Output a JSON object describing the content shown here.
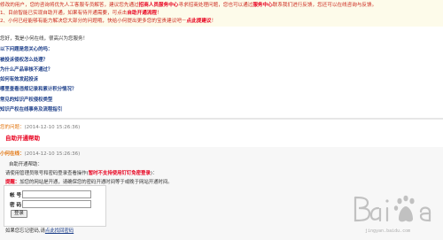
{
  "notice": {
    "line1_a": "修改的用户，您的咨询将优先人工客服专员解答，建议您先通过",
    "line1_hl1": "招商人员服务中心",
    "line1_b": "寻求招商处理问题，您也可以通过",
    "line1_hl2": "服务中心",
    "line1_c": "联系我们进行反馈，您还可以在线咨询与反馈。",
    "line2": "1、目前智能已实现自助开通，如果有待开通需要，可点击",
    "line2_hl": "自助开通流程",
    "line2_tail": "！",
    "line3": "2、小何已经能够有能力解决您大部分的问题哦，快给小何提出更多您的宝贵建议吧－",
    "line3_hl": "点此提建议",
    "line3_tail": "！"
  },
  "chat": {
    "greet_a": "您好，我是小何在线，很高兴为您服务！",
    "head": "以下问题是您关心的吗：",
    "questions": [
      "被投诉侵权怎么处理？",
      "为什么产品审核不通过？",
      "如何有效发起投诉",
      "哪里查看违规记录和累计积分情况？",
      "常见的知识产权侵权类型",
      "知识产权在线事务及流程指引"
    ]
  },
  "bubble": {
    "who": "您的问题：",
    "time": "(2014-12-10 15:26:36)",
    "message": "自助开通帮助"
  },
  "answer": {
    "who": "小何在线：",
    "time": "(2014-12-10 15:26:36)",
    "line1": "自助开通帮助：",
    "line2_a": "请使用管理员账号和密码登录查看操作(",
    "line2_red": "暂时不支持使用钉钉免密登录",
    "line2_b": ")：",
    "line3_warn": "提醒：",
    "line3": "加您的网站是开通，请确保您的密码开通时间等于或晚于网站开通时间。",
    "account_label": "帐  号",
    "password_label": "密  码",
    "account_value": "",
    "password_value": "",
    "login_button": "登录",
    "forgot_a": "如果您忘记密码,请",
    "forgot_link": "点此找回密码"
  },
  "watermark": {
    "url": "jingyan.baidu.com"
  }
}
